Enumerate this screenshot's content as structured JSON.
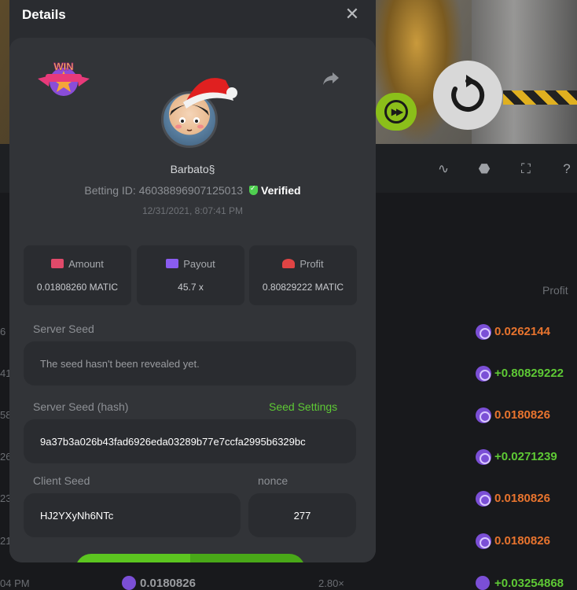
{
  "modal": {
    "title": "Details",
    "close_icon": "close-icon",
    "share_icon": "share-arrow-icon",
    "badge_text": "WIN",
    "username": "Barbato§",
    "betting_id_label": "Betting ID: 460388969071250​13",
    "verified_label": "Verified",
    "timestamp": "12/31/2021, 8:07:41 PM",
    "stats": [
      {
        "label": "Amount",
        "value": "0.01808260 MATIC",
        "icon": "wallet-icon",
        "color": "#e04a6a"
      },
      {
        "label": "Payout",
        "value": "45.7 x",
        "icon": "card-icon",
        "color": "#8a5cf0"
      },
      {
        "label": "Profit",
        "value": "0.80829222 MATIC",
        "icon": "profit-hand-icon",
        "color": "#e04444"
      }
    ],
    "server_seed_label": "Server Seed",
    "server_seed_value": "The seed hasn't been revealed yet.",
    "server_seed_hash_label": "Server Seed (hash)",
    "seed_settings_label": "Seed Settings",
    "server_seed_hash_value": "9a37b3a026b43fad6926eda03289b77e7ccfa2995b6329bc",
    "client_seed_label": "Client Seed",
    "client_seed_value": "HJ2YXyNh6NTc",
    "nonce_label": "nonce",
    "nonce_value": "277"
  },
  "background": {
    "profit_header": "Profit",
    "rows": [
      {
        "left": "6",
        "value": "0.0262144",
        "color": "orange"
      },
      {
        "left": "41",
        "value": "+0.80829222",
        "color": "green"
      },
      {
        "left": "58",
        "value": "0.0180826",
        "color": "orange"
      },
      {
        "left": "26",
        "value": "+0.0271239",
        "color": "green"
      },
      {
        "left": "23",
        "value": "0.0180826",
        "color": "orange"
      },
      {
        "left": "21",
        "value": "0.0180826",
        "color": "orange"
      }
    ],
    "bottom_row": {
      "time": "04 PM",
      "amount": "0.0180826",
      "mult": "2.80×",
      "profit": "+0.03254868"
    }
  },
  "colors": {
    "accent_green": "#5ec935",
    "loss_orange": "#e8742e"
  }
}
